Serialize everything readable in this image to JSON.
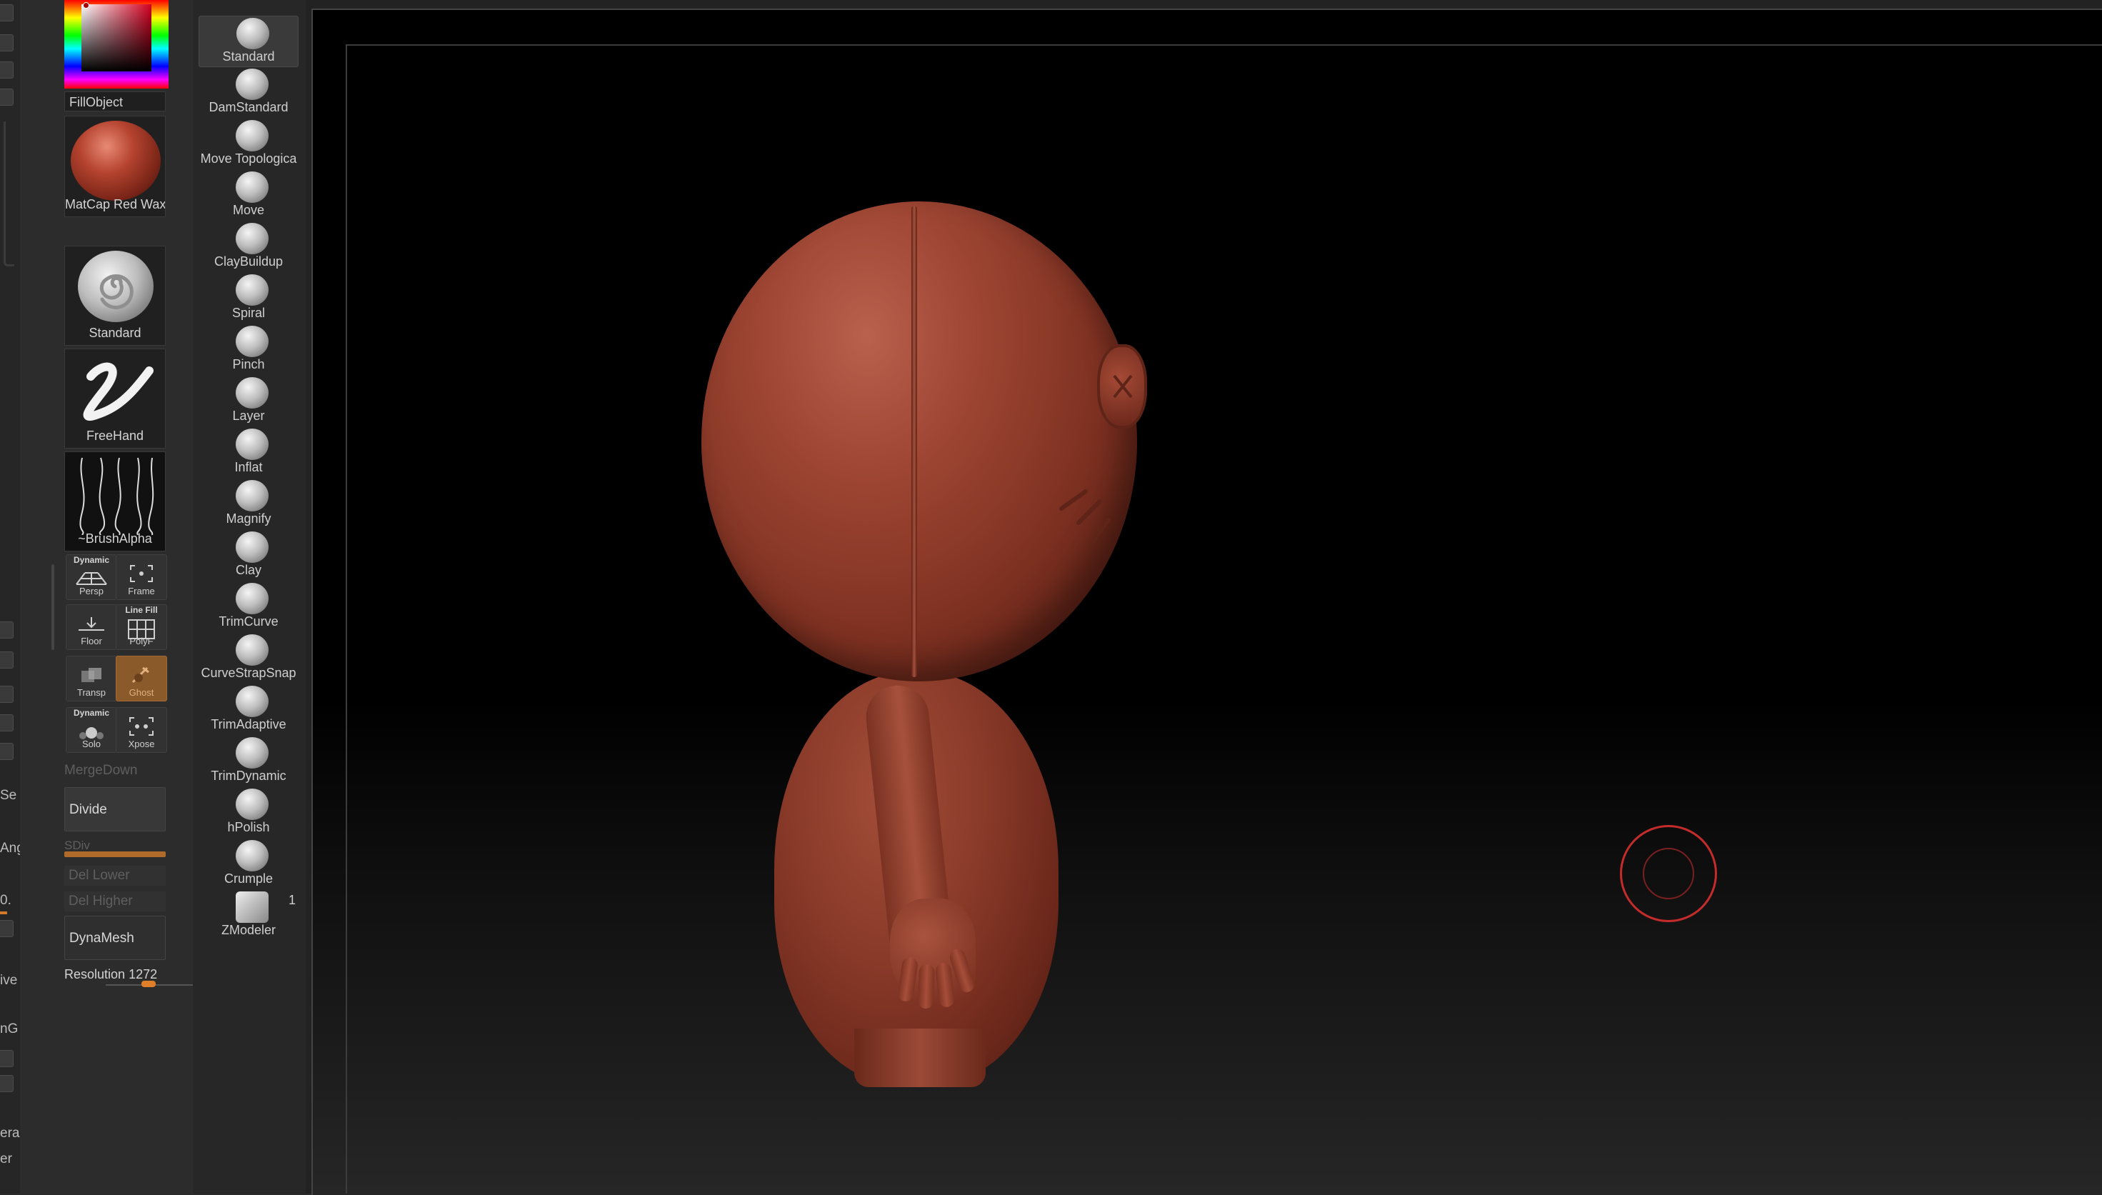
{
  "far_left": {
    "labels": [
      "Se",
      "Ang",
      "0.",
      "ive",
      "nG",
      "era",
      "er"
    ]
  },
  "color_picker": {
    "main_color": "#d40020"
  },
  "fill_object": "FillObject",
  "material": {
    "label": "MatCap Red Wax"
  },
  "brush": {
    "label": "Standard"
  },
  "stroke": {
    "label": "FreeHand"
  },
  "alpha": {
    "label": "~BrushAlpha"
  },
  "view_buttons": {
    "persp": {
      "top": "Dynamic",
      "label": "Persp"
    },
    "frame": {
      "label": "Frame"
    },
    "floor": {
      "label": "Floor"
    },
    "polyf": {
      "top": "Line Fill",
      "label": "PolyF"
    },
    "transp": {
      "label": "Transp"
    },
    "ghost": {
      "label": "Ghost"
    },
    "solo": {
      "top": "Dynamic",
      "label": "Solo"
    },
    "xpose": {
      "label": "Xpose"
    }
  },
  "geometry": {
    "merge_down": "MergeDown",
    "divide": "Divide",
    "sdiv": "SDiv",
    "del_lower": "Del Lower",
    "del_higher": "Del Higher",
    "dynamesh": "DynaMesh",
    "resolution_label": "Resolution",
    "resolution_value": "1272"
  },
  "brushes": [
    "Standard",
    "DamStandard",
    "Move Topologica",
    "Move",
    "ClayBuildup",
    "Spiral",
    "Pinch",
    "Layer",
    "Inflat",
    "Magnify",
    "Clay",
    "TrimCurve",
    "CurveStrapSnap",
    "TrimAdaptive",
    "TrimDynamic",
    "hPolish",
    "Crumple",
    "ZModeler"
  ],
  "brush_count": "1",
  "colors": {
    "accent": "#e07f2a",
    "model": "#8a3a29",
    "cursor": "#c42c2c"
  }
}
